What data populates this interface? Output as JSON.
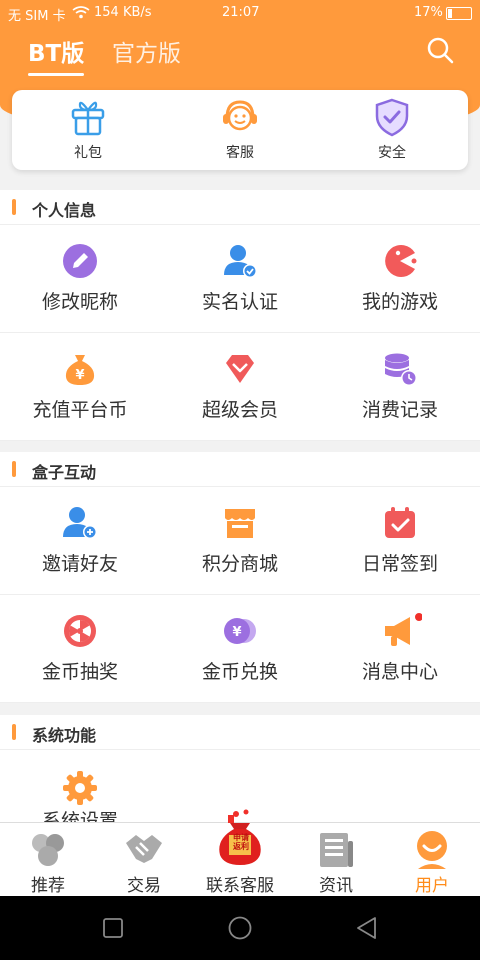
{
  "status": {
    "carrier": "无 SIM 卡",
    "speed": "154 KB/s",
    "time": "21:07",
    "battery": "17%",
    "battery_level": 0.17
  },
  "topnav": {
    "tab_bt": "BT版",
    "tab_official": "官方版"
  },
  "quick": [
    {
      "label": "礼包",
      "icon": "gift-icon"
    },
    {
      "label": "客服",
      "icon": "headset-icon"
    },
    {
      "label": "安全",
      "icon": "shield-icon"
    }
  ],
  "sections": {
    "personal": "个人信息",
    "box": "盒子互动",
    "system": "系统功能"
  },
  "personal_items": [
    "修改昵称",
    "实名认证",
    "我的游戏",
    "充值平台币",
    "超级会员",
    "消费记录"
  ],
  "box_items": [
    "邀请好友",
    "积分商城",
    "日常签到",
    "金币抽奖",
    "金币兑换",
    "消息中心"
  ],
  "system_items": [
    "系统设置"
  ],
  "tabs": {
    "recommend": "推荐",
    "trade": "交易",
    "service": "联系客服",
    "news": "资讯",
    "user": "用户",
    "badge": "申请返利"
  },
  "colors": {
    "accent": "#ff9a3c",
    "tab_active": "#ff8c1a"
  }
}
